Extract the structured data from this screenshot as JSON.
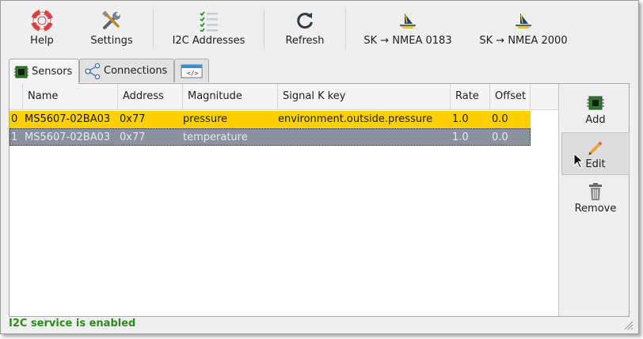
{
  "toolbar": {
    "buttons": [
      {
        "id": "help",
        "label": "Help",
        "icon": "lifebuoy-icon"
      },
      {
        "id": "settings",
        "label": "Settings",
        "icon": "tools-icon"
      },
      {
        "id": "i2c",
        "label": "I2C Addresses",
        "icon": "checklist-icon"
      },
      {
        "id": "refresh",
        "label": "Refresh",
        "icon": "refresh-icon"
      },
      {
        "id": "sk0183",
        "label": "SK → NMEA 0183",
        "icon": "sailboat-icon"
      },
      {
        "id": "sk2000",
        "label": "SK → NMEA 2000",
        "icon": "sailboat-icon"
      }
    ]
  },
  "tabs": [
    {
      "label": "Sensors",
      "icon": "chip-icon",
      "active": true
    },
    {
      "label": "Connections",
      "icon": "share-icon",
      "active": false
    },
    {
      "label": "",
      "icon": "code-window-icon",
      "active": false
    }
  ],
  "table": {
    "columns": [
      "Name",
      "Address",
      "Magnitude",
      "Signal K key",
      "Rate",
      "Offset"
    ],
    "rows": [
      {
        "index": "0",
        "name": "MS5607-02BA03",
        "address": "0x77",
        "magnitude": "pressure",
        "sk_key": "environment.outside.pressure",
        "rate": "1.0",
        "offset": "0.0",
        "state": "selected"
      },
      {
        "index": "1",
        "name": "MS5607-02BA03",
        "address": "0x77",
        "magnitude": "temperature",
        "sk_key": "",
        "rate": "1.0",
        "offset": "0.0",
        "state": "disabled"
      }
    ]
  },
  "side": {
    "add_label": "Add",
    "edit_label": "Edit",
    "remove_label": "Remove"
  },
  "status": {
    "text": "I2C service is enabled",
    "color": "#2a8a1a"
  },
  "colors": {
    "selected_row": "#fdd000",
    "disabled_row": "#8a929d"
  }
}
